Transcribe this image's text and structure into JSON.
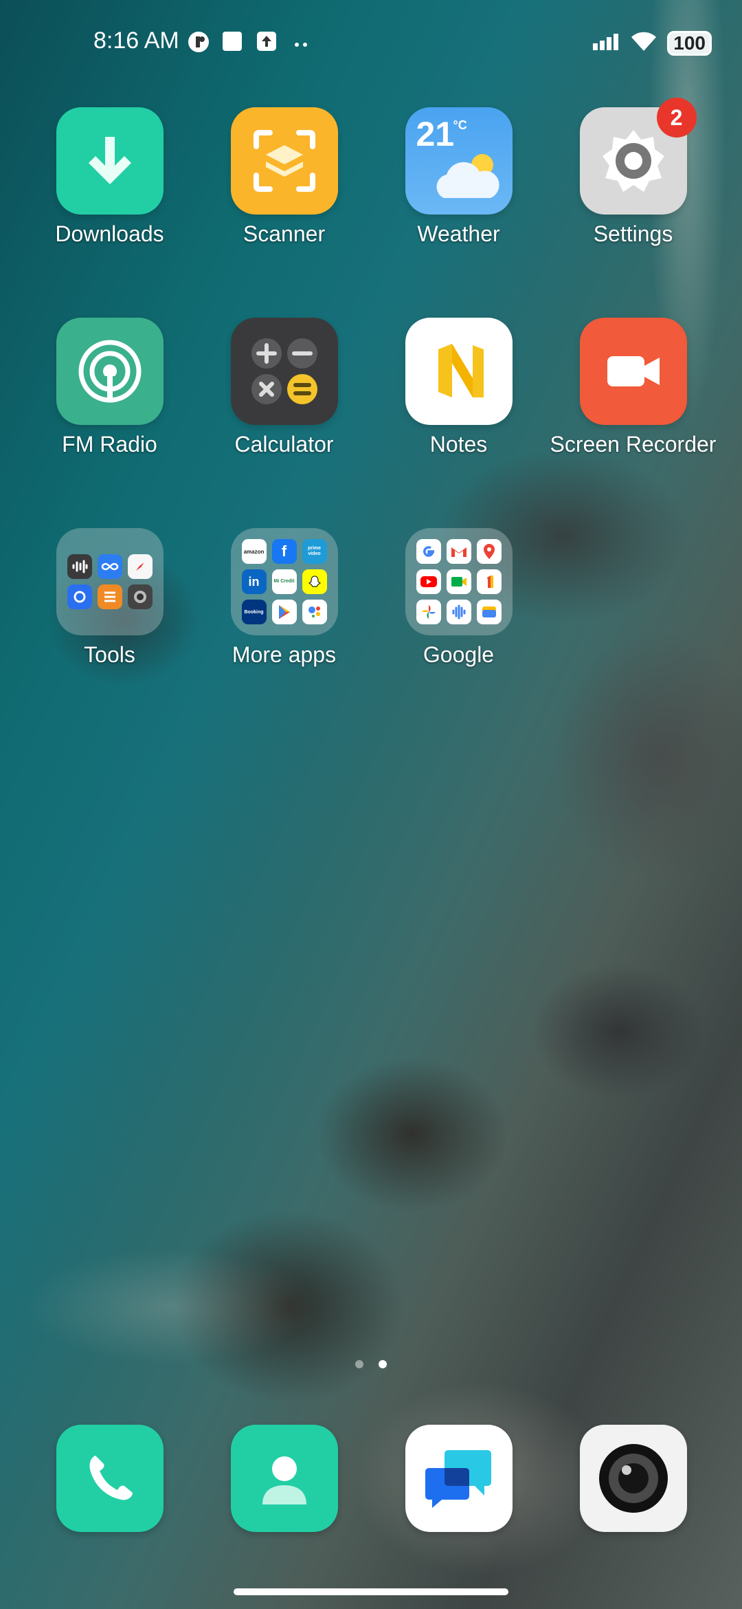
{
  "status_bar": {
    "time": "8:16 AM",
    "battery": "100",
    "icons": [
      "notification-app-icon",
      "square-icon",
      "upload-icon",
      "more-dots-icon",
      "signal-icon",
      "wifi-icon"
    ]
  },
  "apps": {
    "downloads": "Downloads",
    "scanner": "Scanner",
    "weather": "Weather",
    "weather_temp": "21",
    "weather_unit": "°C",
    "settings": "Settings",
    "settings_badge": "2",
    "fm_radio": "FM Radio",
    "calculator": "Calculator",
    "notes": "Notes",
    "screen_recorder": "Screen Recorder"
  },
  "folders": {
    "tools": "Tools",
    "more_apps": "More apps",
    "google": "Google"
  },
  "folder_content": {
    "more_apps_minis": [
      "amazon",
      "f",
      "prime video",
      "in",
      "Mi Credit",
      "",
      "Booking",
      "",
      ""
    ]
  },
  "page_indicator": {
    "count": 2,
    "active": 2
  },
  "dock": [
    "Phone",
    "Contacts",
    "Messages",
    "Camera"
  ],
  "colors": {
    "teal": "#22cfa5",
    "scanner_orange": "#fbb52a",
    "weather_blue": "#4aa3f0",
    "settings_gray": "#d9d9d9",
    "recorder_red": "#f15a3a",
    "calculator_dark": "#3a3a3c",
    "badge_red": "#e8362a"
  }
}
